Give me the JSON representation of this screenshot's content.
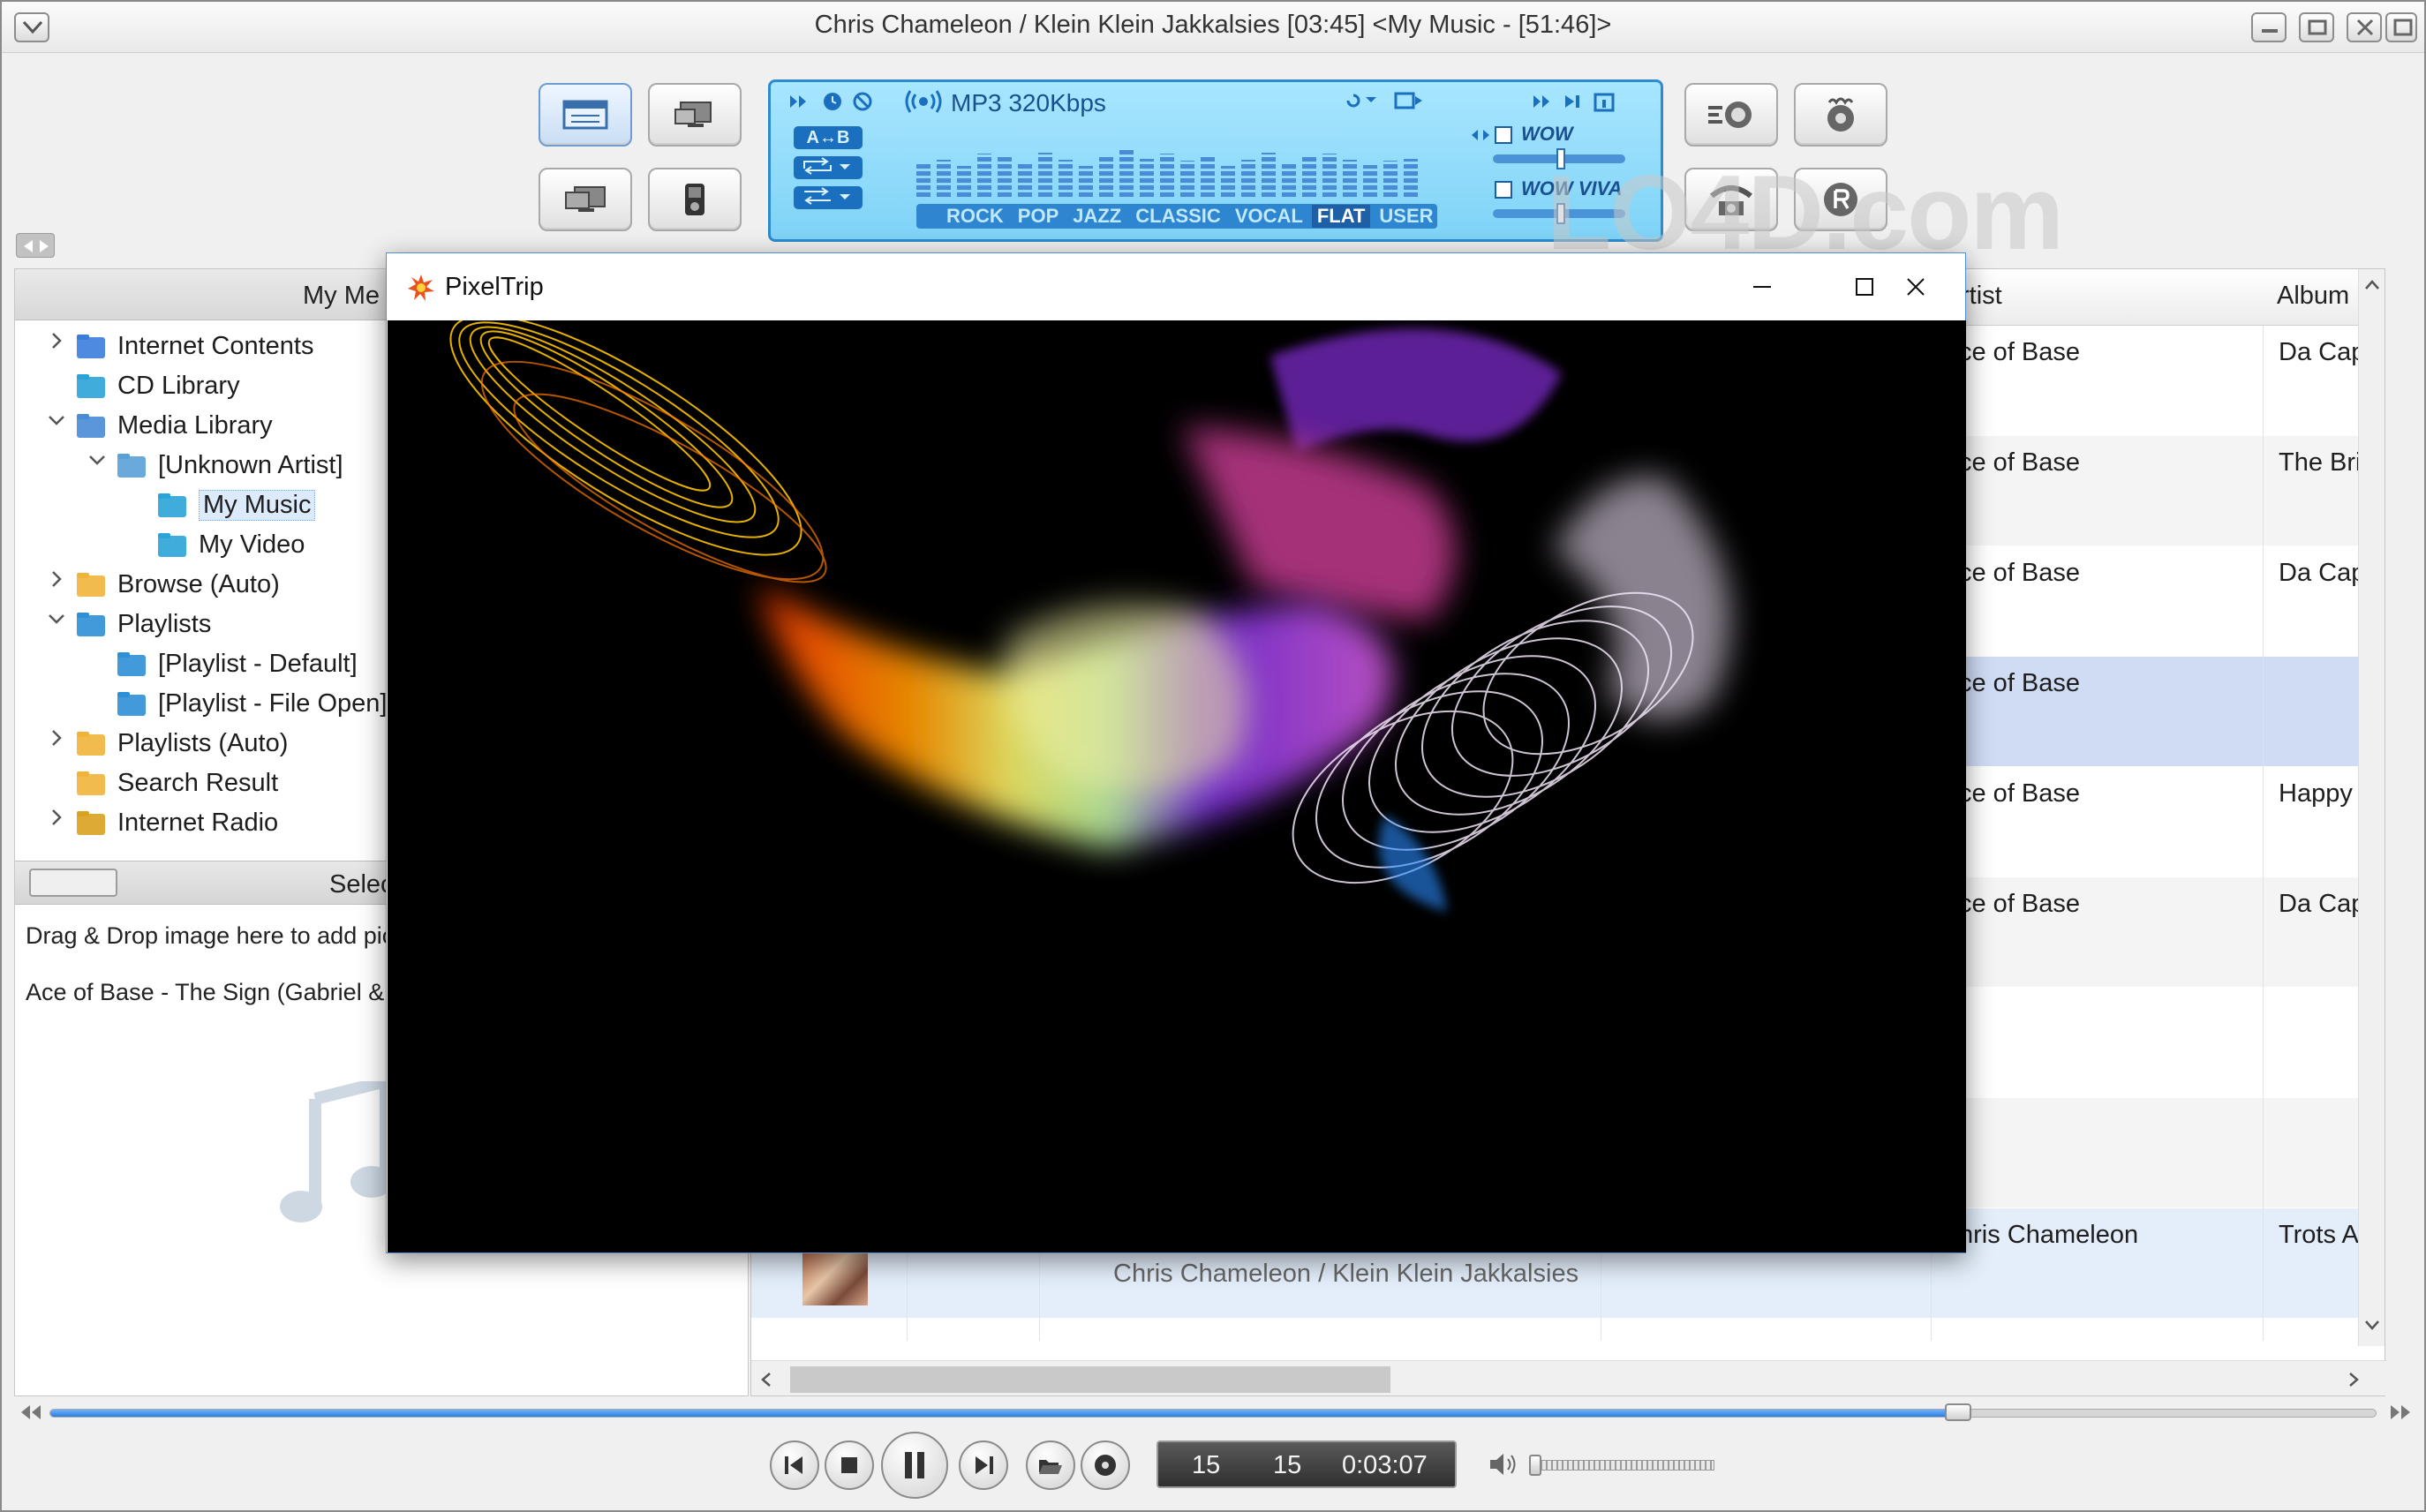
{
  "window": {
    "title": "Chris Chameleon / Klein Klein Jakkalsies  [03:45]    <My Music - [51:46]>",
    "controls": [
      "minimize-icon",
      "restore-icon",
      "close-icon",
      "maximize-icon"
    ]
  },
  "lcd": {
    "format": "MP3 320Kbps",
    "ab_label": "A↔B",
    "presets": [
      "ROCK",
      "POP",
      "JAZZ",
      "CLASSIC",
      "VOCAL",
      "FLAT",
      "USER"
    ],
    "selected_preset": "FLAT",
    "effects": [
      "WOW",
      "WOW VIVA"
    ],
    "colors": {
      "panel": "#7fd3f7",
      "text": "#1a4f91",
      "accent": "#d43f8d"
    }
  },
  "watermark": "LO4D.com",
  "left_panel": {
    "header": "My Me",
    "tree": [
      {
        "label": "Internet Contents",
        "icon": "globe-folder-icon"
      },
      {
        "label": "CD Library",
        "icon": "cd-folder-icon"
      },
      {
        "label": "Media Library",
        "icon": "library-folder-icon"
      },
      {
        "label": "[Unknown Artist]",
        "icon": "artist-icon"
      },
      {
        "label": "My Music",
        "icon": "music-note-icon"
      },
      {
        "label": "My Video",
        "icon": "video-icon"
      },
      {
        "label": "Browse (Auto)",
        "icon": "auto-folder-icon"
      },
      {
        "label": "Playlists",
        "icon": "playlist-folder-icon"
      },
      {
        "label": "[Playlist - Default]",
        "icon": "playlist-icon"
      },
      {
        "label": "[Playlist - File Open]",
        "icon": "playlist-icon"
      },
      {
        "label": "Playlists (Auto)",
        "icon": "auto-playlist-icon"
      },
      {
        "label": "Search Result",
        "icon": "search-folder-icon"
      },
      {
        "label": "Internet Radio",
        "icon": "radio-folder-icon"
      }
    ],
    "selected_item": "My Music",
    "selection_header": "Selec",
    "drop_hint": "Drag & Drop image here to add pict",
    "current_track": "Ace of Base - The Sign (Gabriel & D"
  },
  "list": {
    "columns": {
      "artist": "rtist",
      "album": "Album"
    },
    "rows": [
      {
        "artist": "ce of Base",
        "album": "Da Capo"
      },
      {
        "artist": "ce of Base",
        "album": "The Brid"
      },
      {
        "artist": "ce of Base",
        "album": "Da Capo"
      },
      {
        "artist": "ce of Base",
        "album": ""
      },
      {
        "artist": "ce of Base",
        "album": "Happy N"
      },
      {
        "artist": "ce of Base",
        "album": "Da Capo"
      },
      {
        "artist": "",
        "album": ""
      },
      {
        "artist": "",
        "album": ""
      },
      {
        "artist": "hris Chameleon",
        "album": "Trots Afr",
        "title": "Chris Chameleon / Klein Klein Jakkalsies"
      }
    ],
    "highlighted_row": 3,
    "playing_row": 8
  },
  "transport": {
    "counter_a": "15",
    "counter_b": "15",
    "time": "0:03:07",
    "seek_progress": 0.82,
    "volume": 0.0
  },
  "pixeltrip": {
    "title": "PixelTrip",
    "controls": [
      "minimize-icon",
      "maximize-icon",
      "close-icon"
    ]
  }
}
